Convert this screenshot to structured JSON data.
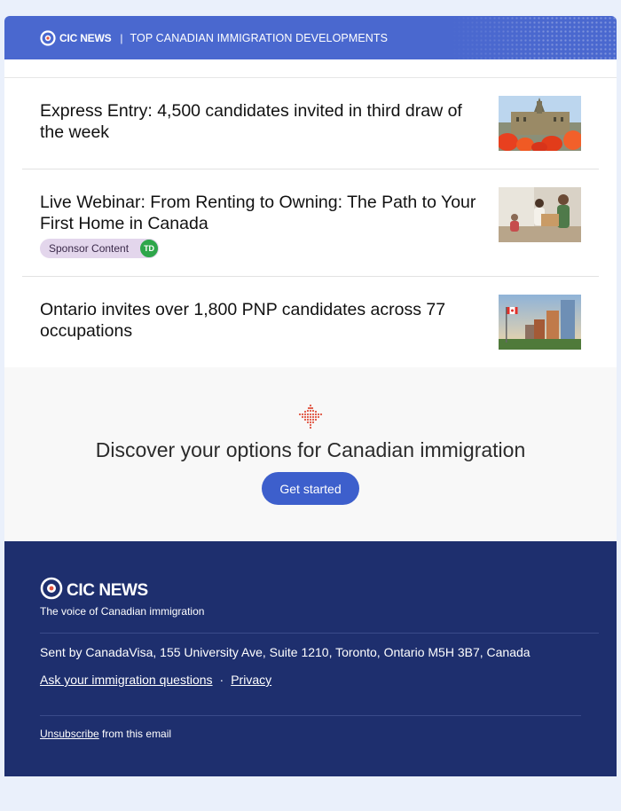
{
  "header": {
    "logo_text": "CIC NEWS",
    "separator": "|",
    "tagline": "TOP CANADIAN IMMIGRATION DEVELOPMENTS"
  },
  "articles": [
    {
      "title": "Express Entry: 4,500 candidates invited in third draw of the week",
      "thumbnail": "parliament-tulips-photo"
    },
    {
      "title": "Live Webinar: From Renting to Owning: The Path to Your First Home in Canada",
      "badge": "Sponsor Content",
      "sponsor_logo": "TD",
      "thumbnail": "family-moving-boxes-photo"
    },
    {
      "title": "Ontario invites over 1,800 PNP candidates across 77 occupations",
      "thumbnail": "ontario-city-flag-photo"
    }
  ],
  "cta": {
    "icon": "maple-leaf-icon",
    "heading": "Discover your options for Canadian immigration",
    "button_label": "Get started"
  },
  "footer": {
    "logo_text": "CIC NEWS",
    "tagline": "The voice of Canadian immigration",
    "address": "Sent by CanadaVisa, 155 University Ave, Suite 1210, Toronto, Ontario M5H 3B7, Canada",
    "links": [
      "Ask your immigration questions",
      "Privacy"
    ],
    "link_separator": "·",
    "unsubscribe_link": "Unsubscribe",
    "unsubscribe_suffix": "from this email"
  },
  "colors": {
    "page_bg": "#eaf0fb",
    "banner": "#4a68cf",
    "button": "#3d5fcc",
    "footer": "#1e2f6e",
    "badge_bg": "#e3d6ec",
    "td_green": "#2ea64a",
    "maple_red": "#e0523f"
  }
}
